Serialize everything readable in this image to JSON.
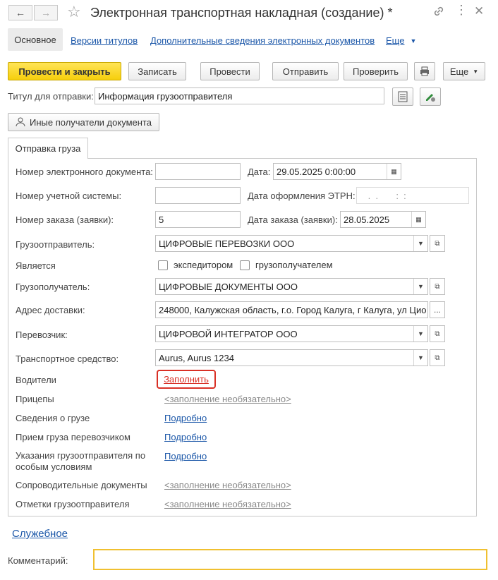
{
  "window": {
    "title": "Электронная транспортная накладная (создание) *"
  },
  "tabs": {
    "main": "Основное",
    "versions": "Версии титулов",
    "extra": "Дополнительные сведения электронных документов",
    "more": "Еще"
  },
  "toolbar": {
    "post_close": "Провести и закрыть",
    "save": "Записать",
    "post": "Провести",
    "send": "Отправить",
    "check": "Проверить",
    "more": "Еще"
  },
  "title_field": {
    "label": "Титул для отправки:",
    "value": "Информация грузоотправителя"
  },
  "other_recipients": "Иные получатели документа",
  "section_tab": "Отправка груза",
  "fields": {
    "doc_number_label": "Номер электронного документа:",
    "doc_number_value": "",
    "date_label": "Дата:",
    "date_value": "29.05.2025  0:00:00",
    "acc_number_label": "Номер учетной системы:",
    "acc_number_value": "",
    "etrn_date_label": "Дата оформления ЭТРН:",
    "etrn_date_value": " .  .       :  :",
    "order_number_label": "Номер заказа (заявки):",
    "order_number_value": "5",
    "order_date_label": "Дата заказа (заявки):",
    "order_date_value": "28.05.2025",
    "shipper_label": "Грузоотправитель:",
    "shipper_value": "ЦИФРОВЫЕ ПЕРЕВОЗКИ ООО",
    "is_label": "Является",
    "forwarder_label": "экспедитором",
    "consignee_cb_label": "грузополучателем",
    "consignee_label": "Грузополучатель:",
    "consignee_value": "ЦИФРОВЫЕ ДОКУМЕНТЫ ООО",
    "address_label": "Адрес доставки:",
    "address_value": "248000, Калужская область, г.о. Город Калуга, г Калуга, ул Цио",
    "carrier_label": "Перевозчик:",
    "carrier_value": "ЦИФРОВОЙ ИНТЕГРАТОР ООО",
    "vehicle_label": "Транспортное средство:",
    "vehicle_value": "Aurus, Aurus 1234",
    "drivers_label": "Водители",
    "drivers_link": "Заполнить",
    "trailers_label": "Прицепы",
    "trailers_link": "<заполнение необязательно>",
    "cargo_label": "Сведения о грузе",
    "cargo_link": "Подробно",
    "acceptance_label": "Прием груза перевозчиком",
    "acceptance_link": "Подробно",
    "instructions_label_1": "Указания грузоотправителя по",
    "instructions_label_2": "особым условиям",
    "instructions_link": "Подробно",
    "accompanying_label": "Сопроводительные документы",
    "accompanying_link": "<заполнение необязательно>",
    "marks_label": "Отметки грузоотправителя",
    "marks_link": "<заполнение необязательно>"
  },
  "service_link": "Служебное",
  "comment": {
    "label": "Комментарий:",
    "value": ""
  },
  "colors": {
    "accent_yellow": "#f6cf0c",
    "link_blue": "#1a56a8",
    "highlight_red": "#d93025"
  }
}
